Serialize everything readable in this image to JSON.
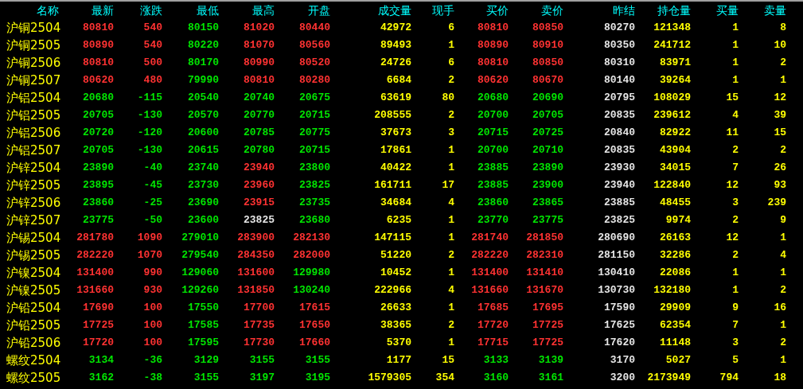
{
  "table": {
    "columns": [
      {
        "label": "名称",
        "kind": "name"
      },
      {
        "label": "最新",
        "kind": "price"
      },
      {
        "label": "涨跌",
        "kind": "price"
      },
      {
        "label": "最低",
        "kind": "price"
      },
      {
        "label": "最高",
        "kind": "price"
      },
      {
        "label": "开盘",
        "kind": "price"
      },
      {
        "label": "成交量",
        "kind": "volume"
      },
      {
        "label": "现手",
        "kind": "volume"
      },
      {
        "label": "买价",
        "kind": "price"
      },
      {
        "label": "卖价",
        "kind": "price"
      },
      {
        "label": "昨结",
        "kind": "settle"
      },
      {
        "label": "持仓量",
        "kind": "volume"
      },
      {
        "label": "买量",
        "kind": "volume"
      },
      {
        "label": "卖量",
        "kind": "volume"
      }
    ],
    "rows": [
      {
        "cells": [
          {
            "text": "沪铜2504"
          },
          {
            "text": "80810",
            "color": "#ff3232"
          },
          {
            "text": "540",
            "color": "#ff3232"
          },
          {
            "text": "80150",
            "color": "#00e600"
          },
          {
            "text": "81020",
            "color": "#ff3232"
          },
          {
            "text": "80440",
            "color": "#ff3232"
          },
          {
            "text": "42972"
          },
          {
            "text": "6"
          },
          {
            "text": "80810",
            "color": "#ff3232"
          },
          {
            "text": "80850",
            "color": "#ff3232"
          },
          {
            "text": "80270"
          },
          {
            "text": "121348"
          },
          {
            "text": "1"
          },
          {
            "text": "8"
          }
        ]
      },
      {
        "cells": [
          {
            "text": "沪铜2505"
          },
          {
            "text": "80890",
            "color": "#ff3232"
          },
          {
            "text": "540",
            "color": "#ff3232"
          },
          {
            "text": "80220",
            "color": "#00e600"
          },
          {
            "text": "81070",
            "color": "#ff3232"
          },
          {
            "text": "80560",
            "color": "#ff3232"
          },
          {
            "text": "89493"
          },
          {
            "text": "1"
          },
          {
            "text": "80890",
            "color": "#ff3232"
          },
          {
            "text": "80910",
            "color": "#ff3232"
          },
          {
            "text": "80350"
          },
          {
            "text": "241712"
          },
          {
            "text": "1"
          },
          {
            "text": "10"
          }
        ]
      },
      {
        "cells": [
          {
            "text": "沪铜2506"
          },
          {
            "text": "80810",
            "color": "#ff3232"
          },
          {
            "text": "500",
            "color": "#ff3232"
          },
          {
            "text": "80170",
            "color": "#00e600"
          },
          {
            "text": "80990",
            "color": "#ff3232"
          },
          {
            "text": "80520",
            "color": "#ff3232"
          },
          {
            "text": "24726"
          },
          {
            "text": "6"
          },
          {
            "text": "80810",
            "color": "#ff3232"
          },
          {
            "text": "80850",
            "color": "#ff3232"
          },
          {
            "text": "80310"
          },
          {
            "text": "83971"
          },
          {
            "text": "1"
          },
          {
            "text": "2"
          }
        ]
      },
      {
        "cells": [
          {
            "text": "沪铜2507"
          },
          {
            "text": "80620",
            "color": "#ff3232"
          },
          {
            "text": "480",
            "color": "#ff3232"
          },
          {
            "text": "79990",
            "color": "#00e600"
          },
          {
            "text": "80810",
            "color": "#ff3232"
          },
          {
            "text": "80280",
            "color": "#ff3232"
          },
          {
            "text": "6684"
          },
          {
            "text": "2"
          },
          {
            "text": "80620",
            "color": "#ff3232"
          },
          {
            "text": "80670",
            "color": "#ff3232"
          },
          {
            "text": "80140"
          },
          {
            "text": "39264"
          },
          {
            "text": "1"
          },
          {
            "text": "1"
          }
        ]
      },
      {
        "cells": [
          {
            "text": "沪铝2504"
          },
          {
            "text": "20680",
            "color": "#00e600"
          },
          {
            "text": "-115",
            "color": "#00e600"
          },
          {
            "text": "20540",
            "color": "#00e600"
          },
          {
            "text": "20740",
            "color": "#00e600"
          },
          {
            "text": "20675",
            "color": "#00e600"
          },
          {
            "text": "63619"
          },
          {
            "text": "80"
          },
          {
            "text": "20680",
            "color": "#00e600"
          },
          {
            "text": "20690",
            "color": "#00e600"
          },
          {
            "text": "20795"
          },
          {
            "text": "108029"
          },
          {
            "text": "15"
          },
          {
            "text": "12"
          }
        ]
      },
      {
        "cells": [
          {
            "text": "沪铝2505"
          },
          {
            "text": "20705",
            "color": "#00e600"
          },
          {
            "text": "-130",
            "color": "#00e600"
          },
          {
            "text": "20570",
            "color": "#00e600"
          },
          {
            "text": "20770",
            "color": "#00e600"
          },
          {
            "text": "20715",
            "color": "#00e600"
          },
          {
            "text": "208555"
          },
          {
            "text": "2"
          },
          {
            "text": "20700",
            "color": "#00e600"
          },
          {
            "text": "20705",
            "color": "#00e600"
          },
          {
            "text": "20835"
          },
          {
            "text": "239612"
          },
          {
            "text": "4"
          },
          {
            "text": "39"
          }
        ]
      },
      {
        "cells": [
          {
            "text": "沪铝2506"
          },
          {
            "text": "20720",
            "color": "#00e600"
          },
          {
            "text": "-120",
            "color": "#00e600"
          },
          {
            "text": "20600",
            "color": "#00e600"
          },
          {
            "text": "20785",
            "color": "#00e600"
          },
          {
            "text": "20775",
            "color": "#00e600"
          },
          {
            "text": "37673"
          },
          {
            "text": "3"
          },
          {
            "text": "20715",
            "color": "#00e600"
          },
          {
            "text": "20725",
            "color": "#00e600"
          },
          {
            "text": "20840"
          },
          {
            "text": "82922"
          },
          {
            "text": "11"
          },
          {
            "text": "15"
          }
        ]
      },
      {
        "cells": [
          {
            "text": "沪铝2507"
          },
          {
            "text": "20705",
            "color": "#00e600"
          },
          {
            "text": "-130",
            "color": "#00e600"
          },
          {
            "text": "20615",
            "color": "#00e600"
          },
          {
            "text": "20780",
            "color": "#00e600"
          },
          {
            "text": "20715",
            "color": "#00e600"
          },
          {
            "text": "17861"
          },
          {
            "text": "1"
          },
          {
            "text": "20700",
            "color": "#00e600"
          },
          {
            "text": "20710",
            "color": "#00e600"
          },
          {
            "text": "20835"
          },
          {
            "text": "43904"
          },
          {
            "text": "2"
          },
          {
            "text": "2"
          }
        ]
      },
      {
        "cells": [
          {
            "text": "沪锌2504"
          },
          {
            "text": "23890",
            "color": "#00e600"
          },
          {
            "text": "-40",
            "color": "#00e600"
          },
          {
            "text": "23740",
            "color": "#00e600"
          },
          {
            "text": "23940",
            "color": "#ff3232"
          },
          {
            "text": "23800",
            "color": "#00e600"
          },
          {
            "text": "40422"
          },
          {
            "text": "1"
          },
          {
            "text": "23885",
            "color": "#00e600"
          },
          {
            "text": "23890",
            "color": "#00e600"
          },
          {
            "text": "23930"
          },
          {
            "text": "34015"
          },
          {
            "text": "7"
          },
          {
            "text": "26"
          }
        ]
      },
      {
        "cells": [
          {
            "text": "沪锌2505"
          },
          {
            "text": "23895",
            "color": "#00e600"
          },
          {
            "text": "-45",
            "color": "#00e600"
          },
          {
            "text": "23730",
            "color": "#00e600"
          },
          {
            "text": "23960",
            "color": "#ff3232"
          },
          {
            "text": "23825",
            "color": "#00e600"
          },
          {
            "text": "161711"
          },
          {
            "text": "17"
          },
          {
            "text": "23885",
            "color": "#00e600"
          },
          {
            "text": "23900",
            "color": "#00e600"
          },
          {
            "text": "23940"
          },
          {
            "text": "122840"
          },
          {
            "text": "12"
          },
          {
            "text": "93"
          }
        ]
      },
      {
        "cells": [
          {
            "text": "沪锌2506"
          },
          {
            "text": "23860",
            "color": "#00e600"
          },
          {
            "text": "-25",
            "color": "#00e600"
          },
          {
            "text": "23690",
            "color": "#00e600"
          },
          {
            "text": "23915",
            "color": "#ff3232"
          },
          {
            "text": "23735",
            "color": "#00e600"
          },
          {
            "text": "34684"
          },
          {
            "text": "4"
          },
          {
            "text": "23860",
            "color": "#00e600"
          },
          {
            "text": "23865",
            "color": "#00e600"
          },
          {
            "text": "23885"
          },
          {
            "text": "48455"
          },
          {
            "text": "3"
          },
          {
            "text": "239"
          }
        ]
      },
      {
        "cells": [
          {
            "text": "沪锌2507"
          },
          {
            "text": "23775",
            "color": "#00e600"
          },
          {
            "text": "-50",
            "color": "#00e600"
          },
          {
            "text": "23600",
            "color": "#00e600"
          },
          {
            "text": "23825",
            "color": "#e6e6e6"
          },
          {
            "text": "23680",
            "color": "#00e600"
          },
          {
            "text": "6235"
          },
          {
            "text": "1"
          },
          {
            "text": "23770",
            "color": "#00e600"
          },
          {
            "text": "23775",
            "color": "#00e600"
          },
          {
            "text": "23825"
          },
          {
            "text": "9974"
          },
          {
            "text": "2"
          },
          {
            "text": "9"
          }
        ]
      },
      {
        "cells": [
          {
            "text": "沪锡2504"
          },
          {
            "text": "281780",
            "color": "#ff3232"
          },
          {
            "text": "1090",
            "color": "#ff3232"
          },
          {
            "text": "279010",
            "color": "#00e600"
          },
          {
            "text": "283900",
            "color": "#ff3232"
          },
          {
            "text": "282130",
            "color": "#ff3232"
          },
          {
            "text": "147115"
          },
          {
            "text": "1"
          },
          {
            "text": "281740",
            "color": "#ff3232"
          },
          {
            "text": "281850",
            "color": "#ff3232"
          },
          {
            "text": "280690"
          },
          {
            "text": "26163"
          },
          {
            "text": "12"
          },
          {
            "text": "1"
          }
        ]
      },
      {
        "cells": [
          {
            "text": "沪锡2505"
          },
          {
            "text": "282220",
            "color": "#ff3232"
          },
          {
            "text": "1070",
            "color": "#ff3232"
          },
          {
            "text": "279540",
            "color": "#00e600"
          },
          {
            "text": "284350",
            "color": "#ff3232"
          },
          {
            "text": "282000",
            "color": "#ff3232"
          },
          {
            "text": "51220"
          },
          {
            "text": "2"
          },
          {
            "text": "282220",
            "color": "#ff3232"
          },
          {
            "text": "282310",
            "color": "#ff3232"
          },
          {
            "text": "281150"
          },
          {
            "text": "32286"
          },
          {
            "text": "2"
          },
          {
            "text": "4"
          }
        ]
      },
      {
        "cells": [
          {
            "text": "沪镍2504"
          },
          {
            "text": "131400",
            "color": "#ff3232"
          },
          {
            "text": "990",
            "color": "#ff3232"
          },
          {
            "text": "129060",
            "color": "#00e600"
          },
          {
            "text": "131600",
            "color": "#ff3232"
          },
          {
            "text": "129980",
            "color": "#00e600"
          },
          {
            "text": "10452"
          },
          {
            "text": "1"
          },
          {
            "text": "131400",
            "color": "#ff3232"
          },
          {
            "text": "131410",
            "color": "#ff3232"
          },
          {
            "text": "130410"
          },
          {
            "text": "22086"
          },
          {
            "text": "1"
          },
          {
            "text": "1"
          }
        ]
      },
      {
        "cells": [
          {
            "text": "沪镍2505"
          },
          {
            "text": "131660",
            "color": "#ff3232"
          },
          {
            "text": "930",
            "color": "#ff3232"
          },
          {
            "text": "129260",
            "color": "#00e600"
          },
          {
            "text": "131850",
            "color": "#ff3232"
          },
          {
            "text": "130240",
            "color": "#00e600"
          },
          {
            "text": "222966"
          },
          {
            "text": "4"
          },
          {
            "text": "131660",
            "color": "#ff3232"
          },
          {
            "text": "131670",
            "color": "#ff3232"
          },
          {
            "text": "130730"
          },
          {
            "text": "132180"
          },
          {
            "text": "1"
          },
          {
            "text": "2"
          }
        ]
      },
      {
        "cells": [
          {
            "text": "沪铅2504"
          },
          {
            "text": "17690",
            "color": "#ff3232"
          },
          {
            "text": "100",
            "color": "#ff3232"
          },
          {
            "text": "17550",
            "color": "#00e600"
          },
          {
            "text": "17700",
            "color": "#ff3232"
          },
          {
            "text": "17615",
            "color": "#ff3232"
          },
          {
            "text": "26633"
          },
          {
            "text": "1"
          },
          {
            "text": "17685",
            "color": "#ff3232"
          },
          {
            "text": "17695",
            "color": "#ff3232"
          },
          {
            "text": "17590"
          },
          {
            "text": "29909"
          },
          {
            "text": "9"
          },
          {
            "text": "16"
          }
        ]
      },
      {
        "cells": [
          {
            "text": "沪铅2505"
          },
          {
            "text": "17725",
            "color": "#ff3232"
          },
          {
            "text": "100",
            "color": "#ff3232"
          },
          {
            "text": "17585",
            "color": "#00e600"
          },
          {
            "text": "17735",
            "color": "#ff3232"
          },
          {
            "text": "17650",
            "color": "#ff3232"
          },
          {
            "text": "38365"
          },
          {
            "text": "2"
          },
          {
            "text": "17720",
            "color": "#ff3232"
          },
          {
            "text": "17725",
            "color": "#ff3232"
          },
          {
            "text": "17625"
          },
          {
            "text": "62354"
          },
          {
            "text": "7"
          },
          {
            "text": "1"
          }
        ]
      },
      {
        "cells": [
          {
            "text": "沪铅2506"
          },
          {
            "text": "17720",
            "color": "#ff3232"
          },
          {
            "text": "100",
            "color": "#ff3232"
          },
          {
            "text": "17595",
            "color": "#00e600"
          },
          {
            "text": "17730",
            "color": "#ff3232"
          },
          {
            "text": "17660",
            "color": "#ff3232"
          },
          {
            "text": "5370"
          },
          {
            "text": "1"
          },
          {
            "text": "17715",
            "color": "#ff3232"
          },
          {
            "text": "17725",
            "color": "#ff3232"
          },
          {
            "text": "17620"
          },
          {
            "text": "11148"
          },
          {
            "text": "3"
          },
          {
            "text": "2"
          }
        ]
      },
      {
        "cells": [
          {
            "text": "螺纹2504"
          },
          {
            "text": "3134",
            "color": "#00e600"
          },
          {
            "text": "-36",
            "color": "#00e600"
          },
          {
            "text": "3129",
            "color": "#00e600"
          },
          {
            "text": "3155",
            "color": "#00e600"
          },
          {
            "text": "3155",
            "color": "#00e600"
          },
          {
            "text": "1177"
          },
          {
            "text": "15"
          },
          {
            "text": "3133",
            "color": "#00e600"
          },
          {
            "text": "3139",
            "color": "#00e600"
          },
          {
            "text": "3170"
          },
          {
            "text": "5027"
          },
          {
            "text": "5"
          },
          {
            "text": "1"
          }
        ]
      },
      {
        "cells": [
          {
            "text": "螺纹2505"
          },
          {
            "text": "3162",
            "color": "#00e600"
          },
          {
            "text": "-38",
            "color": "#00e600"
          },
          {
            "text": "3155",
            "color": "#00e600"
          },
          {
            "text": "3197",
            "color": "#00e600"
          },
          {
            "text": "3195",
            "color": "#00e600"
          },
          {
            "text": "1579305"
          },
          {
            "text": "354"
          },
          {
            "text": "3160",
            "color": "#00e600"
          },
          {
            "text": "3161",
            "color": "#00e600"
          },
          {
            "text": "3200"
          },
          {
            "text": "2173949"
          },
          {
            "text": "794"
          },
          {
            "text": "18"
          }
        ]
      }
    ]
  }
}
